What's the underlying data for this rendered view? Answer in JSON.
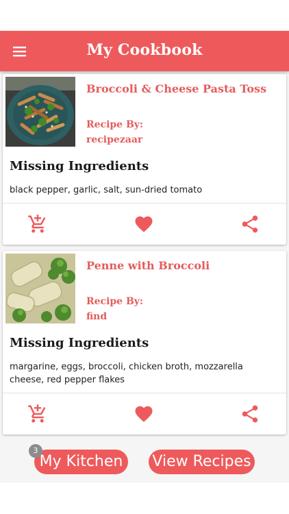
{
  "app": {
    "title": "My Cookbook",
    "accent_color": "#ee5a5c",
    "menu_icon": "hamburger-menu-icon"
  },
  "recipes": [
    {
      "title": "Broccoli & Cheese Pasta Toss",
      "recipe_by_label": "Recipe By:",
      "source": "recipezaar",
      "missing_heading": "Missing Ingredients",
      "missing_ingredients": "black pepper, garlic, salt, sun-dried tomato",
      "thumbnail": "pasta-with-broccoli-plate-image"
    },
    {
      "title": "Penne with Broccoli",
      "recipe_by_label": "Recipe By:",
      "source": "find",
      "missing_heading": "Missing Ingredients",
      "missing_ingredients": "margarine, eggs, broccoli, chicken broth, mozzarella cheese, red pepper flakes",
      "thumbnail": "penne-with-broccoli-closeup-image"
    }
  ],
  "card_actions": {
    "add_to_cart_icon": "add-shopping-cart-icon",
    "favorite_icon": "heart-icon",
    "share_icon": "share-icon"
  },
  "bottom": {
    "kitchen_label": "My Kitchen",
    "kitchen_badge": "3",
    "view_recipes_label": "View Recipes"
  }
}
